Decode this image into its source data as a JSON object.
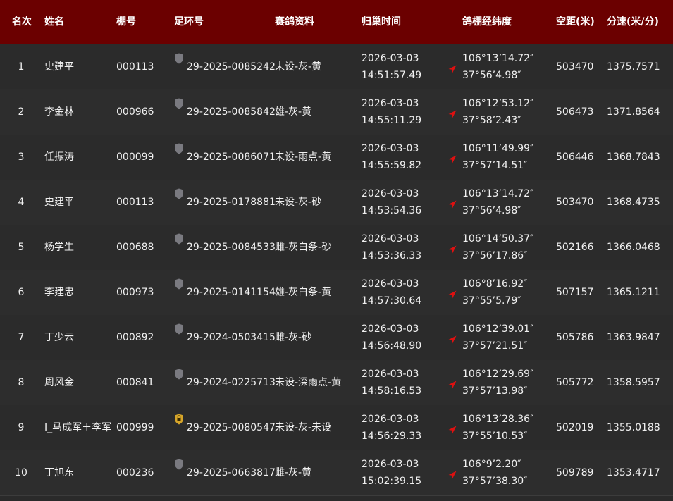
{
  "header": {
    "rank": "名次",
    "name": "姓名",
    "loft": "棚号",
    "ring": "足环号",
    "info": "赛鸽资料",
    "arrival": "归巢时间",
    "coord": "鸽棚经纬度",
    "distance": "空距(米)",
    "speed": "分速(米/分)"
  },
  "colors": {
    "header_bg": "#6b0000",
    "row_bg": "#2b2b2b",
    "arrow": "#e01010",
    "shield_gray": "#7a7a80",
    "shield_gold": "#d6a52a"
  },
  "rows": [
    {
      "rank": "1",
      "name": "史建平",
      "loft": "000113",
      "ring_icon": "shield-gray-icon",
      "ring": "29-2025-0085242",
      "info": "未设-灰-黄",
      "date": "2026-03-03",
      "time": "14:51:57.49",
      "lon": "106°13’14.72″",
      "lat": "37°56’4.98″",
      "distance": "503470",
      "speed": "1375.7571"
    },
    {
      "rank": "2",
      "name": "李金林",
      "loft": "000966",
      "ring_icon": "shield-gray-icon",
      "ring": "29-2025-0085842",
      "info": "雄-灰-黄",
      "date": "2026-03-03",
      "time": "14:55:11.29",
      "lon": "106°12’53.12″",
      "lat": "37°58’2.43″",
      "distance": "506473",
      "speed": "1371.8564"
    },
    {
      "rank": "3",
      "name": "任振涛",
      "loft": "000099",
      "ring_icon": "shield-gray-icon",
      "ring": "29-2025-0086071",
      "info": "未设-雨点-黄",
      "date": "2026-03-03",
      "time": "14:55:59.82",
      "lon": "106°11’49.99″",
      "lat": "37°57’14.51″",
      "distance": "506446",
      "speed": "1368.7843"
    },
    {
      "rank": "4",
      "name": "史建平",
      "loft": "000113",
      "ring_icon": "shield-gray-icon",
      "ring": "29-2025-0178881",
      "info": "未设-灰-砂",
      "date": "2026-03-03",
      "time": "14:53:54.36",
      "lon": "106°13’14.72″",
      "lat": "37°56’4.98″",
      "distance": "503470",
      "speed": "1368.4735"
    },
    {
      "rank": "5",
      "name": "杨学生",
      "loft": "000688",
      "ring_icon": "shield-gray-icon",
      "ring": "29-2025-0084533",
      "info": "雌-灰白条-砂",
      "date": "2026-03-03",
      "time": "14:53:36.33",
      "lon": "106°14’50.37″",
      "lat": "37°56’17.86″",
      "distance": "502166",
      "speed": "1366.0468"
    },
    {
      "rank": "6",
      "name": "李建忠",
      "loft": "000973",
      "ring_icon": "shield-gray-icon",
      "ring": "29-2025-0141154",
      "info": "雄-灰白条-黄",
      "date": "2026-03-03",
      "time": "14:57:30.64",
      "lon": "106°8’16.92″",
      "lat": "37°55’5.79″",
      "distance": "507157",
      "speed": "1365.1211"
    },
    {
      "rank": "7",
      "name": "丁少云",
      "loft": "000892",
      "ring_icon": "shield-gray-icon",
      "ring": "29-2024-0503415",
      "info": "雌-灰-砂",
      "date": "2026-03-03",
      "time": "14:56:48.90",
      "lon": "106°12’39.01″",
      "lat": "37°57’21.51″",
      "distance": "505786",
      "speed": "1363.9847"
    },
    {
      "rank": "8",
      "name": "周风金",
      "loft": "000841",
      "ring_icon": "shield-gray-icon",
      "ring": "29-2024-0225713",
      "info": "未设-深雨点-黄",
      "date": "2026-03-03",
      "time": "14:58:16.53",
      "lon": "106°12’29.69″",
      "lat": "37°57’13.98″",
      "distance": "505772",
      "speed": "1358.5957"
    },
    {
      "rank": "9",
      "name": "I_马成军＋李军",
      "loft": "000999",
      "ring_icon": "shield-gold-icon",
      "ring": "29-2025-0080547",
      "info": "未设-灰-未设",
      "date": "2026-03-03",
      "time": "14:56:29.33",
      "lon": "106°13’28.36″",
      "lat": "37°55’10.53″",
      "distance": "502019",
      "speed": "1355.0188"
    },
    {
      "rank": "10",
      "name": "丁旭东",
      "loft": "000236",
      "ring_icon": "shield-gray-icon",
      "ring": "29-2025-0663817",
      "info": "雌-灰-黄",
      "date": "2026-03-03",
      "time": "15:02:39.15",
      "lon": "106°9’2.20″",
      "lat": "37°57’38.30″",
      "distance": "509789",
      "speed": "1353.4717"
    }
  ]
}
